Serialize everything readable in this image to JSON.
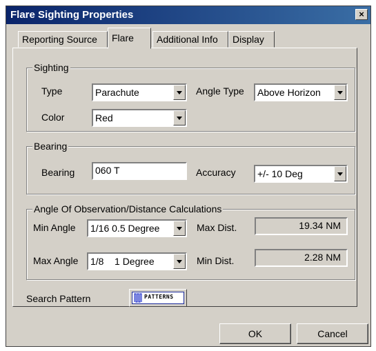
{
  "window": {
    "title": "Flare Sighting Properties",
    "close_glyph": "×"
  },
  "tabs": [
    {
      "label": "Reporting Source"
    },
    {
      "label": "Flare"
    },
    {
      "label": "Additional Info"
    },
    {
      "label": "Display"
    }
  ],
  "sighting": {
    "legend": "Sighting",
    "type_label": "Type",
    "type_value": "Parachute",
    "angle_type_label": "Angle Type",
    "angle_type_value": "Above Horizon",
    "color_label": "Color",
    "color_value": "Red"
  },
  "bearing": {
    "legend": "Bearing",
    "bearing_label": "Bearing",
    "bearing_value": "060 T",
    "accuracy_label": "Accuracy",
    "accuracy_value": "+/- 10 Deg"
  },
  "observation": {
    "legend": "Angle Of Observation/Distance  Calculations",
    "min_angle_label": "Min Angle",
    "min_angle_value": "1/16  0.5 Degree",
    "max_dist_label": "Max Dist.",
    "max_dist_value": "19.34 NM",
    "max_angle_label": "Max Angle",
    "max_angle_value": "1/8    1 Degree",
    "min_dist_label": "Min Dist.",
    "min_dist_value": "2.28 NM"
  },
  "search_pattern": {
    "label": "Search Pattern",
    "button_text": "PATTERNS"
  },
  "footer": {
    "ok_label": "OK",
    "cancel_label": "Cancel"
  }
}
